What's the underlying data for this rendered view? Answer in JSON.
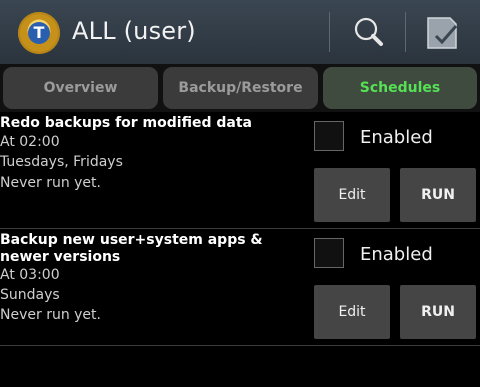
{
  "header": {
    "title": "ALL (user)",
    "logo_letter": "T",
    "search_icon": "search-icon",
    "select_icon": "checklist-icon"
  },
  "tabs": [
    {
      "label": "Overview",
      "active": false
    },
    {
      "label": "Backup/Restore",
      "active": false
    },
    {
      "label": "Schedules",
      "active": true
    }
  ],
  "schedules": [
    {
      "name": "Redo backups for modified data",
      "time": "At 02:00",
      "days": "Tuesdays, Fridays",
      "status": "Never run yet.",
      "enabled_label": "Enabled",
      "edit_label": "Edit",
      "run_label": "RUN",
      "enabled": false
    },
    {
      "name": "Backup new user+system apps & newer versions",
      "time": "At 03:00",
      "days": "Sundays",
      "status": "Never run yet.",
      "enabled_label": "Enabled",
      "edit_label": "Edit",
      "run_label": "RUN",
      "enabled": false
    }
  ],
  "colors": {
    "accent_tab_text": "#55e055",
    "actionbar": "#2f3943"
  }
}
